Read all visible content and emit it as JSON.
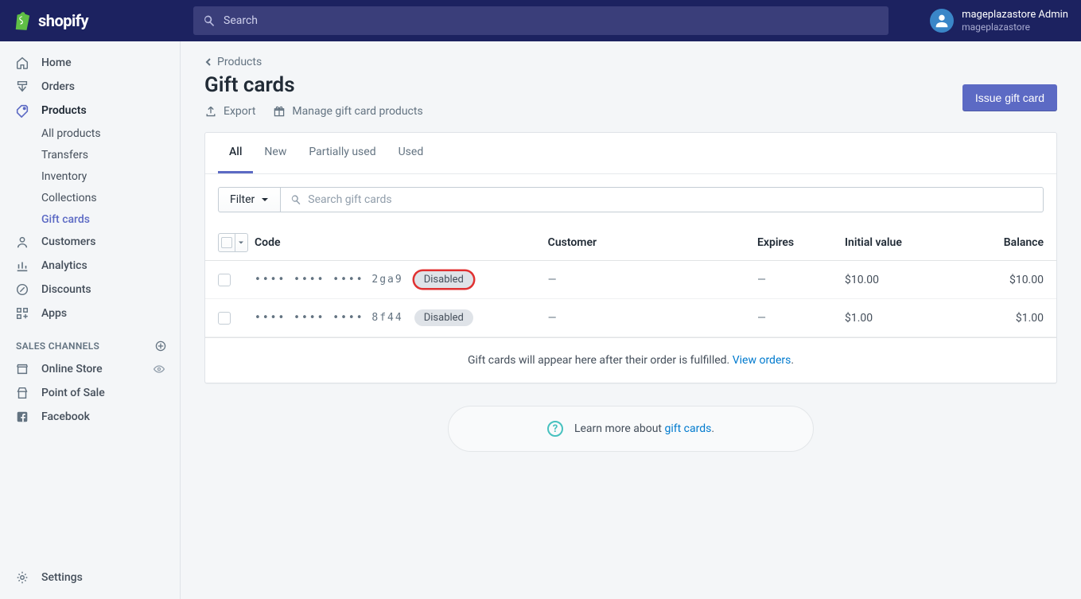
{
  "brand": "shopify",
  "search_placeholder": "Search",
  "user": {
    "name": "mageplazastore Admin",
    "store": "mageplazastore"
  },
  "sidebar": {
    "items": [
      {
        "label": "Home",
        "icon": "home"
      },
      {
        "label": "Orders",
        "icon": "orders"
      },
      {
        "label": "Products",
        "icon": "products",
        "active": true
      },
      {
        "label": "Customers",
        "icon": "customers"
      },
      {
        "label": "Analytics",
        "icon": "analytics"
      },
      {
        "label": "Discounts",
        "icon": "discounts"
      },
      {
        "label": "Apps",
        "icon": "apps"
      }
    ],
    "sub": [
      {
        "label": "All products"
      },
      {
        "label": "Transfers"
      },
      {
        "label": "Inventory"
      },
      {
        "label": "Collections"
      },
      {
        "label": "Gift cards",
        "active": true
      }
    ],
    "channels_header": "SALES CHANNELS",
    "channels": [
      {
        "label": "Online Store",
        "eye": true
      },
      {
        "label": "Point of Sale"
      },
      {
        "label": "Facebook"
      }
    ],
    "settings": "Settings"
  },
  "breadcrumb": "Products",
  "page_title": "Gift cards",
  "actions": {
    "export": "Export",
    "manage": "Manage gift card products",
    "primary": "Issue gift card"
  },
  "tabs": [
    "All",
    "New",
    "Partially used",
    "Used"
  ],
  "filter_label": "Filter",
  "search_cards_placeholder": "Search gift cards",
  "columns": {
    "code": "Code",
    "customer": "Customer",
    "expires": "Expires",
    "initial": "Initial value",
    "balance": "Balance"
  },
  "rows": [
    {
      "code": "•••• •••• •••• 2ga9",
      "status": "Disabled",
      "customer": "—",
      "expires": "—",
      "initial": "$10.00",
      "balance": "$10.00",
      "highlighted": true
    },
    {
      "code": "•••• •••• •••• 8f44",
      "status": "Disabled",
      "customer": "—",
      "expires": "—",
      "initial": "$1.00",
      "balance": "$1.00",
      "highlighted": false
    }
  ],
  "footer_text": "Gift cards will appear here after their order is fulfilled. ",
  "footer_link": "View orders",
  "learn_text": "Learn more about ",
  "learn_link": "gift cards"
}
